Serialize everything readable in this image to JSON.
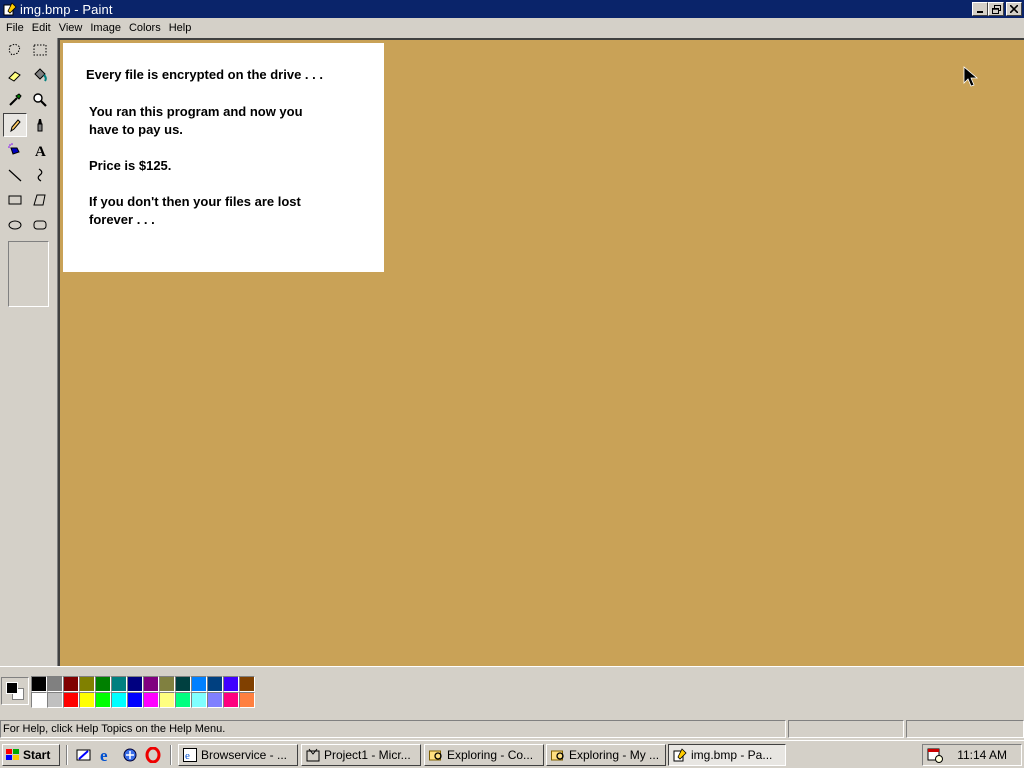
{
  "window": {
    "title": "img.bmp - Paint",
    "min_label": "_",
    "max_label": "□",
    "close_label": "×"
  },
  "menu": {
    "items": [
      "File",
      "Edit",
      "View",
      "Image",
      "Colors",
      "Help"
    ]
  },
  "tools": [
    "free-form-select",
    "select",
    "eraser",
    "fill-with-color",
    "pick-color",
    "magnifier",
    "pencil",
    "brush",
    "airbrush",
    "text",
    "line",
    "curve",
    "rectangle",
    "polygon",
    "ellipse",
    "rounded-rectangle"
  ],
  "active_tool": "pencil",
  "canvas": {
    "background_color": "#c9a257",
    "note_lines": [
      "Every file is encrypted on the drive . . .",
      "You ran this program and now you",
      "have to pay us.",
      "Price is $125.",
      "If you don't then your files are lost",
      "forever . . ."
    ]
  },
  "palette": {
    "foreground": "#000000",
    "background": "#ffffff",
    "colors_row1": [
      "#000000",
      "#808080",
      "#800000",
      "#808000",
      "#008000",
      "#008080",
      "#000080",
      "#800080",
      "#808040",
      "#004040",
      "#0080ff",
      "#004080",
      "#4000ff",
      "#804000"
    ],
    "colors_row2": [
      "#ffffff",
      "#c0c0c0",
      "#ff0000",
      "#ffff00",
      "#00ff00",
      "#00ffff",
      "#0000ff",
      "#ff00ff",
      "#ffff80",
      "#00ff80",
      "#80ffff",
      "#8080ff",
      "#ff0080",
      "#ff8040"
    ]
  },
  "statusbar": {
    "help_text": "For Help, click Help Topics on the Help Menu."
  },
  "taskbar": {
    "start_label": "Start",
    "tasks": [
      {
        "label": "Browservice - ...",
        "icon": "browser-icon"
      },
      {
        "label": "Project1 - Micr...",
        "icon": "vb-project-icon"
      },
      {
        "label": "Exploring - Co...",
        "icon": "explorer-icon"
      },
      {
        "label": "Exploring - My ...",
        "icon": "explorer-icon"
      },
      {
        "label": "img.bmp - Pa...",
        "icon": "paint-icon"
      }
    ],
    "clock": "11:14 AM"
  }
}
